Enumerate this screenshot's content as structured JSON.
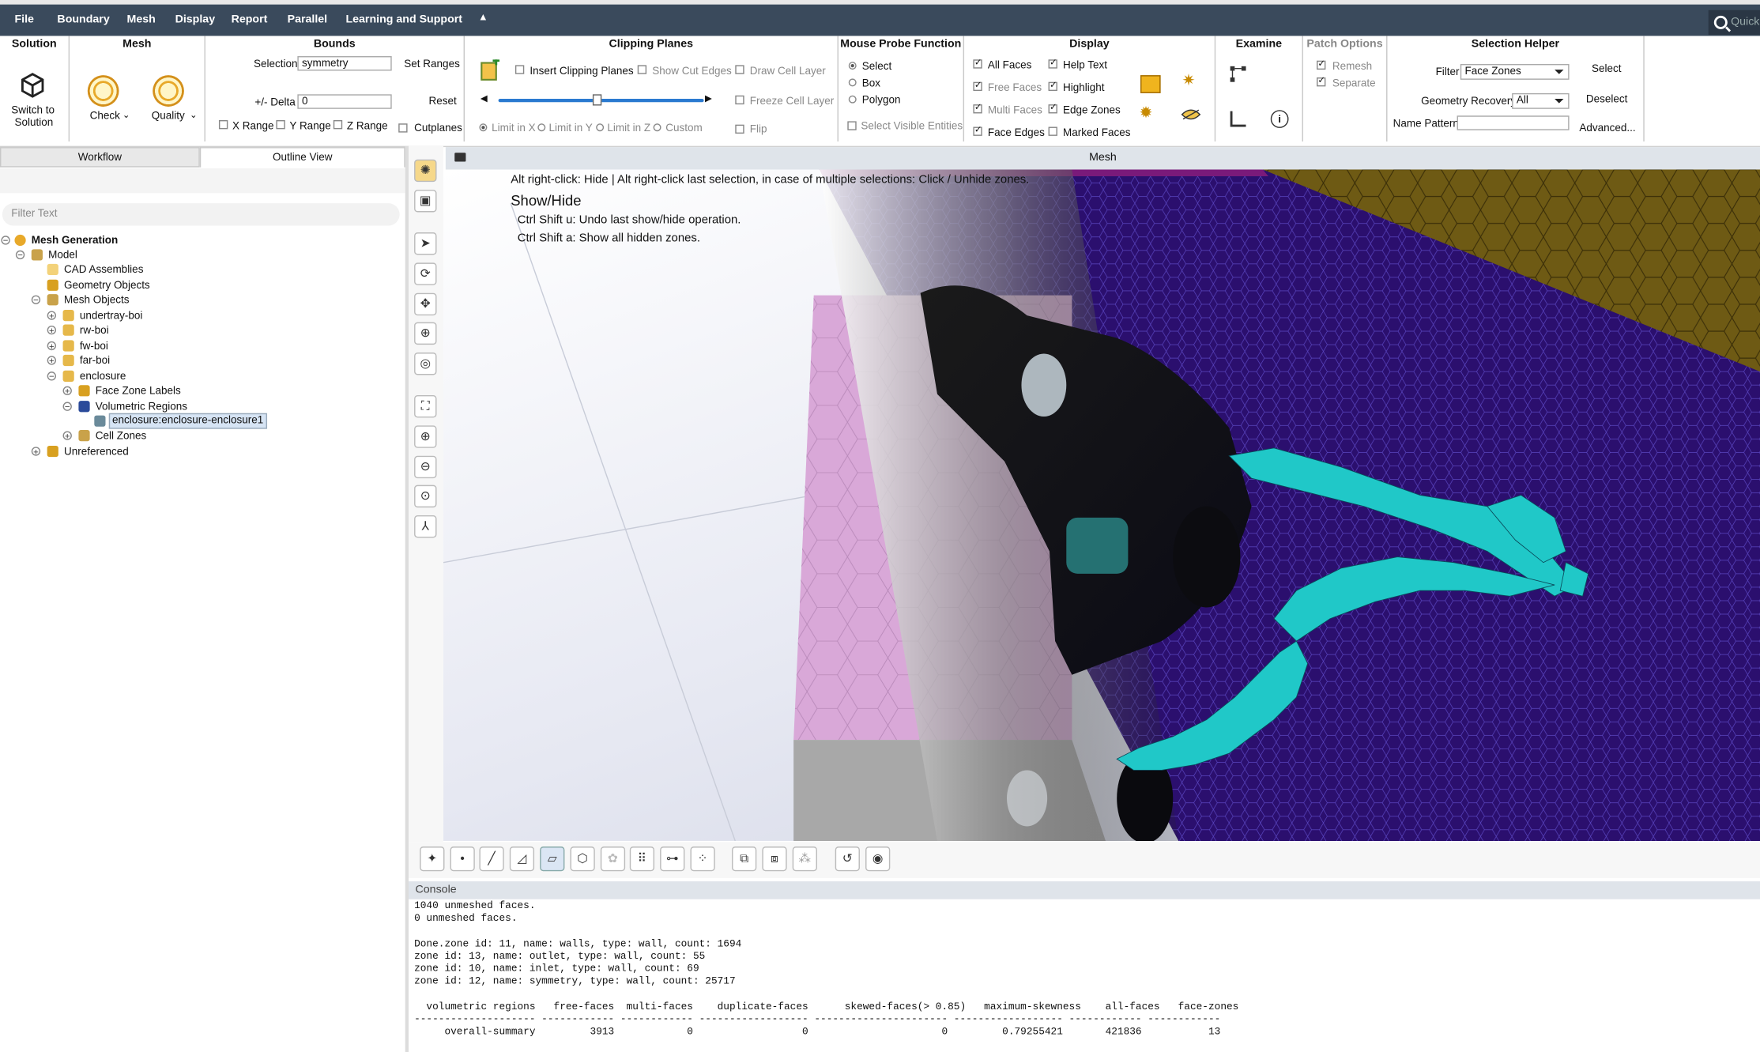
{
  "menubar": {
    "items": [
      "File",
      "Boundary",
      "Mesh",
      "Display",
      "Report",
      "Parallel",
      "Learning and Support"
    ],
    "quick_search": "Quick S"
  },
  "ribbon": {
    "solution": {
      "title": "Solution",
      "switch_label_1": "Switch to",
      "switch_label_2": "Solution"
    },
    "mesh": {
      "title": "Mesh",
      "check": "Check",
      "quality": "Quality"
    },
    "bounds": {
      "title": "Bounds",
      "selection_label": "Selection",
      "selection_value": "symmetry",
      "set_ranges": "Set Ranges",
      "delta_label": "+/- Delta",
      "delta_value": "0",
      "reset": "Reset",
      "x_range": "X Range",
      "y_range": "Y Range",
      "z_range": "Z Range",
      "cutplanes": "Cutplanes"
    },
    "clipping": {
      "title": "Clipping Planes",
      "insert": "Insert Clipping Planes",
      "show_cut": "Show Cut Edges",
      "draw_cell": "Draw Cell Layer",
      "freeze_cell": "Freeze Cell Layer",
      "flip": "Flip",
      "limit_x": "Limit in X",
      "limit_y": "Limit in Y",
      "limit_z": "Limit in Z",
      "custom": "Custom"
    },
    "probe": {
      "title": "Mouse Probe Function",
      "select": "Select",
      "box": "Box",
      "polygon": "Polygon",
      "select_visible": "Select Visible Entities"
    },
    "display": {
      "title": "Display",
      "all_faces": "All Faces",
      "free_faces": "Free Faces",
      "multi_faces": "Multi Faces",
      "face_edges": "Face Edges",
      "help_text": "Help Text",
      "highlight": "Highlight",
      "edge_zones": "Edge Zones",
      "marked_faces": "Marked Faces"
    },
    "examine": {
      "title": "Examine"
    },
    "patch": {
      "title": "Patch Options",
      "remesh": "Remesh",
      "separate": "Separate"
    },
    "selection_helper": {
      "title": "Selection Helper",
      "filter_label": "Filter",
      "filter_value": "Face Zones",
      "select": "Select",
      "geom_label": "Geometry Recovery",
      "geom_value": "All",
      "deselect": "Deselect",
      "name_pattern": "Name Pattern",
      "advanced": "Advanced..."
    }
  },
  "left": {
    "tabs": [
      "Workflow",
      "Outline View"
    ],
    "filter_placeholder": "Filter Text",
    "tree": {
      "mesh_generation": "Mesh Generation",
      "model": "Model",
      "cad": "CAD Assemblies",
      "geometry": "Geometry Objects",
      "mesh_objects": "Mesh Objects",
      "undertray": "undertray-boi",
      "rw": "rw-boi",
      "fw": "fw-boi",
      "far": "far-boi",
      "enclosure": "enclosure",
      "face_zone_labels": "Face Zone Labels",
      "volumetric": "Volumetric Regions",
      "enclosure_region": "enclosure:enclosure-enclosure1",
      "cell_zones": "Cell Zones",
      "unreferenced": "Unreferenced"
    }
  },
  "viewport": {
    "title": "Mesh",
    "help_line1": "Alt right-click: Hide | Alt right-click last selection, in case of multiple selections: Click / Unhide zones.",
    "help_heading": "Show/Hide",
    "help_line2": "Ctrl Shift u: Undo last show/hide operation.",
    "help_line3": "Ctrl Shift a: Show all hidden zones."
  },
  "colors": {
    "menubar": "#3a4a5c",
    "floor_mesh": "#2b0f6e",
    "wall_mesh": "#6e5a14",
    "highlight_cells": "#20c8c8",
    "enclosure_pink": "#d9a8d8"
  },
  "console": {
    "title": "Console",
    "lines": [
      "1040 unmeshed faces.",
      "0 unmeshed faces.",
      "",
      "Done.zone id: 11, name: walls, type: wall, count: 1694",
      "zone id: 13, name: outlet, type: wall, count: 55",
      "zone id: 10, name: inlet, type: wall, count: 69",
      "zone id: 12, name: symmetry, type: wall, count: 25717",
      "",
      "  volumetric regions   free-faces  multi-faces    duplicate-faces      skewed-faces(> 0.85)   maximum-skewness    all-faces   face-zones",
      "-------------------- ------------ ------------ ------------------ ---------------------- ------------------ ------------ ------------",
      "     overall-summary         3913            0                  0                      0         0.79255421       421836           13"
    ]
  }
}
